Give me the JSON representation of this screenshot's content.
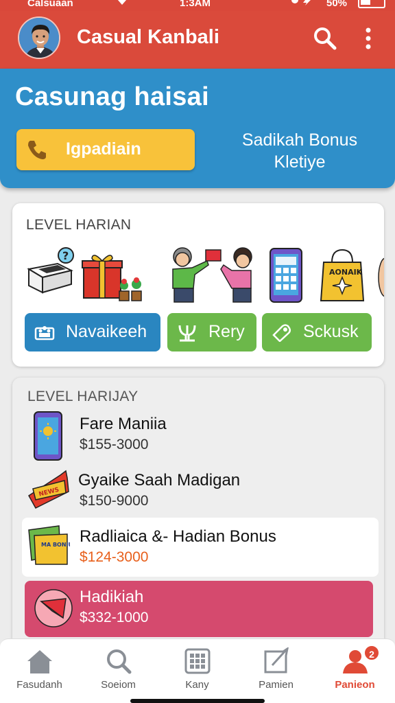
{
  "status_bar": {
    "carrier": "Calsuaan",
    "time": "1:3AM",
    "battery": "50%"
  },
  "app_bar": {
    "title": "Casual Kanbali",
    "actions": [
      "search-icon",
      "more-vertical-icon"
    ]
  },
  "hero": {
    "title": "Casunag haisai",
    "primary_button": "Igpadiain",
    "bonus_line1": "Sadikah Bonus",
    "bonus_line2": "Kletiye"
  },
  "daily_card": {
    "title": "LEVEL HARIAN",
    "illustrations": [
      "gift-box-question-icon",
      "red-gift-icon",
      "kids-exchange-gift-icon",
      "calculator-phone-icon",
      "shopping-bag-icon"
    ],
    "shopping_bag_text": "AONAIK",
    "chips": [
      {
        "label": "Navaikeeh",
        "icon": "team-icon",
        "color": "#2a86c0"
      },
      {
        "label": "Rery",
        "icon": "plant-icon",
        "color": "#6cb84a"
      },
      {
        "label": "Sckusk",
        "icon": "tag-icon",
        "color": "#6cb84a"
      }
    ]
  },
  "levels_card": {
    "title": "LEVEL HARIJAY",
    "items": [
      {
        "name": "Fare Maniia",
        "range": "$155-3000",
        "icon": "phone-sun-icon"
      },
      {
        "name": "Gyaike Saah Madigan",
        "range": "$150-9000",
        "icon": "news-ribbon-icon",
        "icon_text": "NEWS"
      },
      {
        "name": "Radliaica &- Hadian Bonus",
        "range": "$124-3000",
        "icon": "card-packet-icon",
        "icon_text": "MA BONIUS"
      },
      {
        "name": "Hadikiah",
        "range": "$332-1000",
        "icon": "red-ticket-icon"
      }
    ]
  },
  "bottom_nav": {
    "items": [
      {
        "label": "Fasudanh",
        "icon": "home-icon"
      },
      {
        "label": "Soeiom",
        "icon": "search-icon"
      },
      {
        "label": "Kany",
        "icon": "keypad-icon"
      },
      {
        "label": "Pamien",
        "icon": "note-icon"
      },
      {
        "label": "Panieon",
        "icon": "people-icon",
        "badge": "2",
        "active": true
      }
    ]
  },
  "colors": {
    "primary_red": "#da4a3b",
    "hero_blue": "#2f8fc9",
    "accent_yellow": "#f8c23a",
    "chip_green": "#6cb84a",
    "pink_row": "#d54a6e"
  }
}
